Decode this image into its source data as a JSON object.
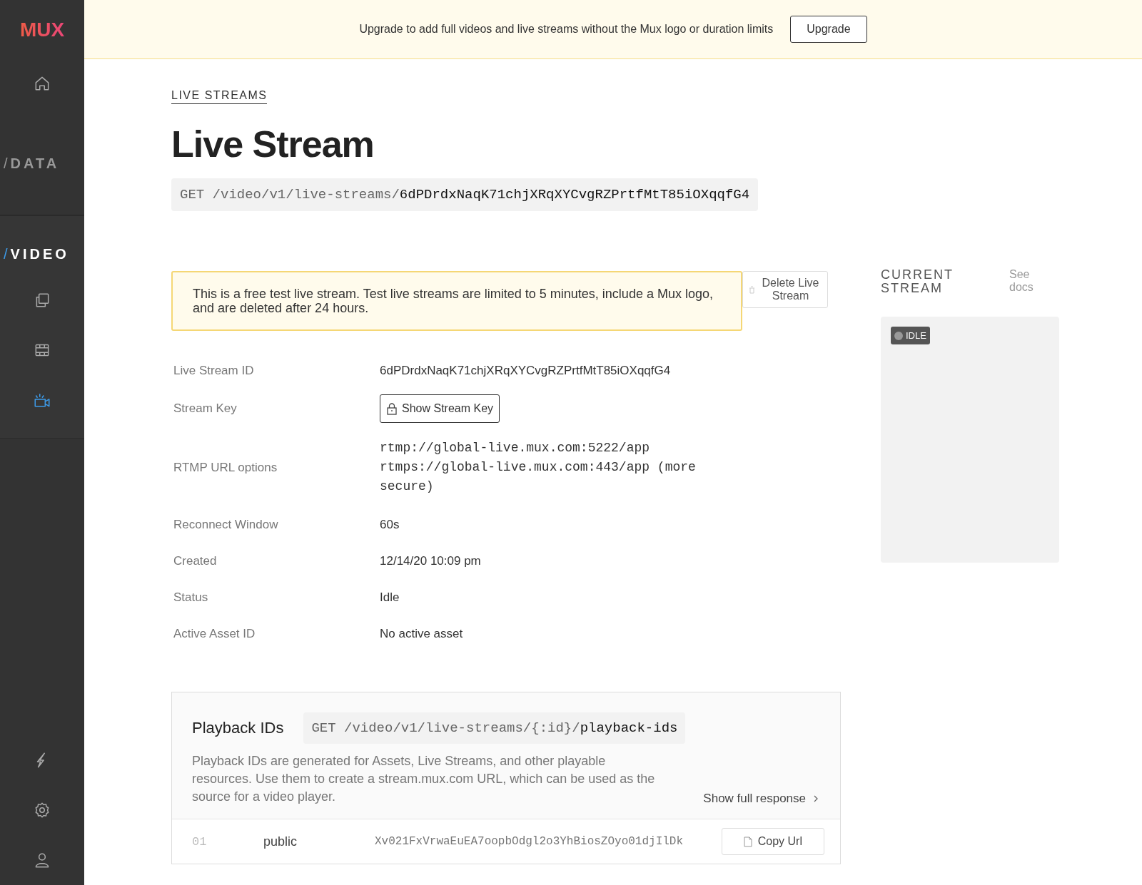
{
  "sidebar": {
    "logo": "MUX",
    "top_items": [
      {
        "kind": "home",
        "selected": false
      }
    ],
    "sections": [
      {
        "slash": "/",
        "label": "DATA",
        "selected": false
      },
      {
        "slash": "/",
        "label": "VIDEO",
        "selected": true,
        "items": [
          {
            "kind": "assets",
            "selected": false
          },
          {
            "kind": "film",
            "selected": false
          },
          {
            "kind": "camera",
            "selected": true
          }
        ]
      }
    ],
    "bottom_items": [
      {
        "kind": "bolt",
        "selected": false
      },
      {
        "kind": "settings",
        "selected": false
      },
      {
        "kind": "user",
        "selected": false
      }
    ]
  },
  "banner": {
    "text": "Upgrade to add full videos and live streams without the Mux logo or duration limits",
    "button": "Upgrade"
  },
  "breadcrumb": "LIVE STREAMS",
  "title": "Live Stream",
  "endpoint": {
    "method": "GET",
    "path": "/video/v1/live-streams/",
    "id": "6dPDrdxNaqK71chjXRqXYCvgRZPrtfMtT85iOXqqfG4"
  },
  "notice": "This is a free test live stream. Test live streams are limited to 5 minutes, include a Mux logo, and are deleted after 24 hours.",
  "delete_button": "Delete Live Stream",
  "details": [
    {
      "label": "Live Stream ID",
      "kind": "text",
      "value": "6dPDrdxNaqK71chjXRqXYCvgRZPrtfMtT85iOXqqfG4"
    },
    {
      "label": "Stream Key",
      "kind": "button",
      "value": "Show Stream Key"
    },
    {
      "label": "RTMP URL options",
      "kind": "code",
      "lines": [
        "rtmp://global-live.mux.com:5222/app",
        "rtmps://global-live.mux.com:443/app (more secure)"
      ]
    },
    {
      "label": "Reconnect Window",
      "kind": "text",
      "value": "60s"
    },
    {
      "label": "Created",
      "kind": "text",
      "value": "12/14/20 10:09 pm"
    },
    {
      "label": "Status",
      "kind": "text",
      "value": "Idle"
    },
    {
      "label": "Active Asset ID",
      "kind": "text",
      "value": "No active asset"
    }
  ],
  "current_stream": {
    "title": "CURRENT STREAM",
    "docs_link": "See docs",
    "status": "IDLE"
  },
  "playback": {
    "title": "Playback IDs",
    "endpoint": {
      "method": "GET",
      "path": "/video/v1/live-streams/{:id}/",
      "tail": "playback-ids"
    },
    "description": "Playback IDs are generated for Assets, Live Streams, and other playable resources. Use them to create a stream.mux.com URL, which can be used as the source for a video player.",
    "show_full": "Show full response",
    "rows": [
      {
        "index": "01",
        "policy": "public",
        "id": "Xv021FxVrwaEuEA7oopbOdgl2o3YhBiosZOyo01djIlDk",
        "button": "Copy Url"
      }
    ]
  }
}
